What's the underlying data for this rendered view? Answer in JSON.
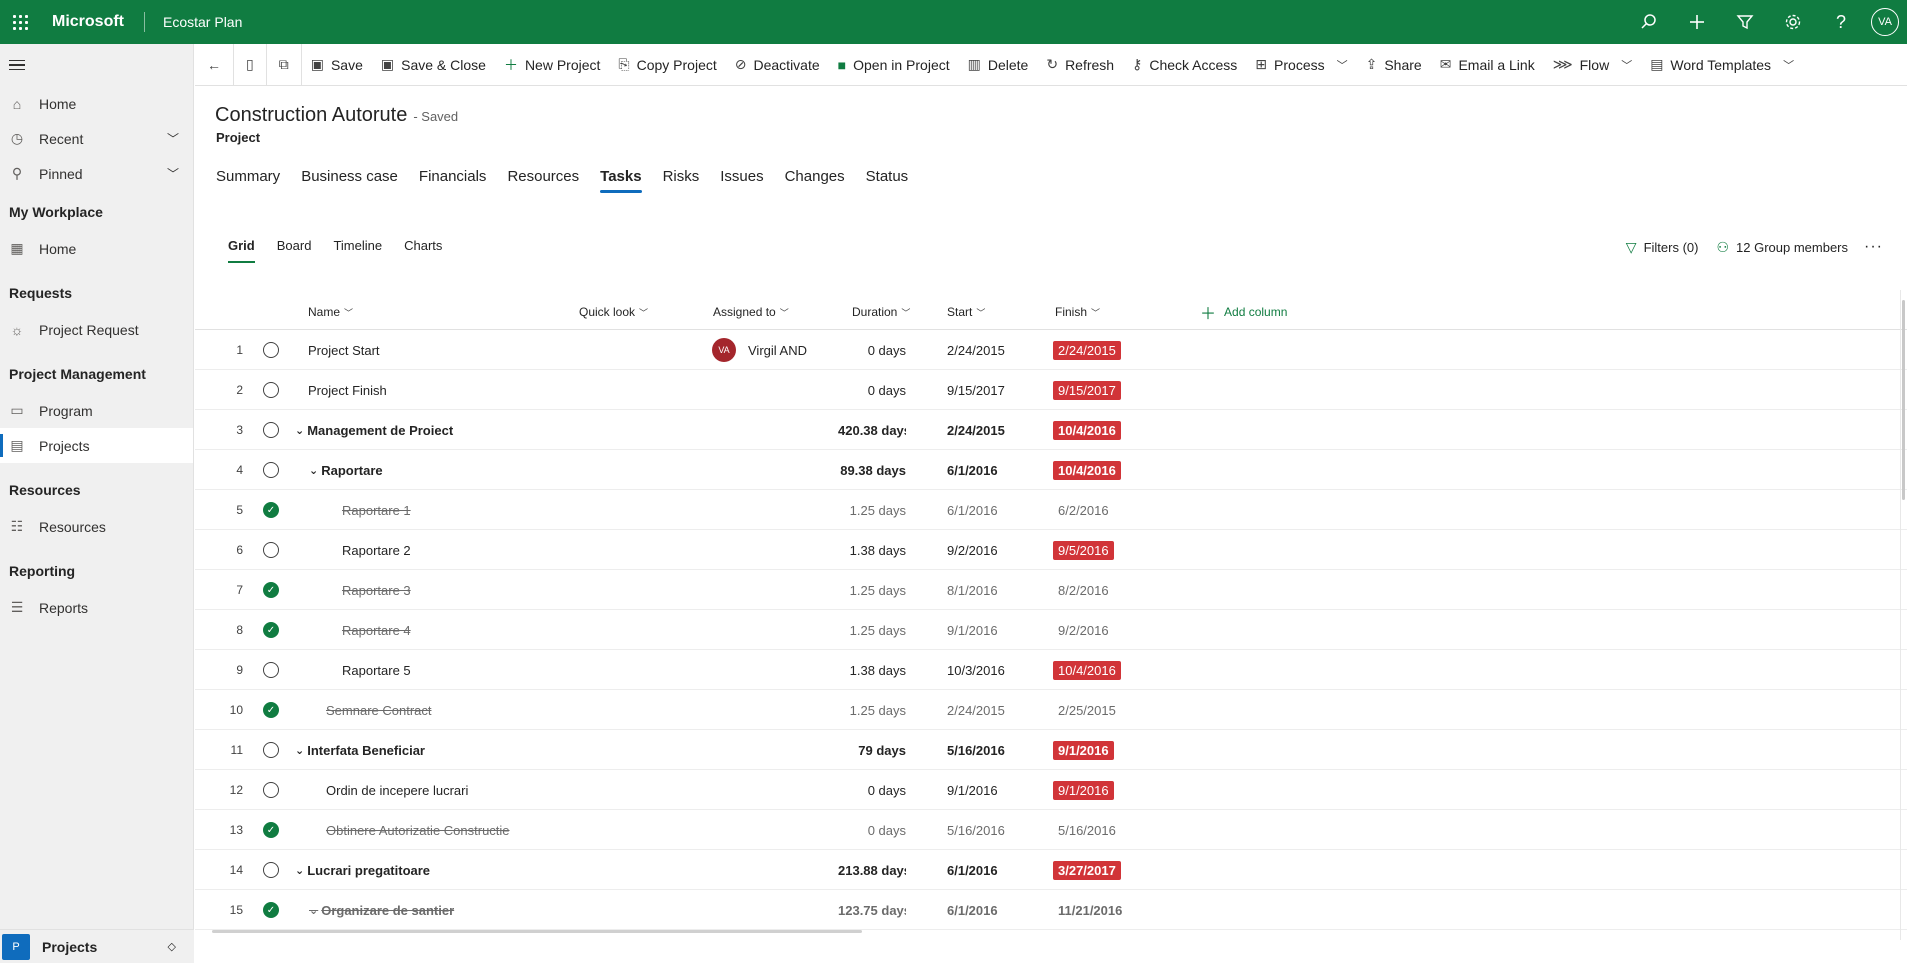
{
  "topbar": {
    "brand": "Microsoft",
    "app_name": "Ecostar Plan",
    "avatar_initials": "VA",
    "icons": [
      "search-icon",
      "plus-icon",
      "filter-icon",
      "gear-icon",
      "help-icon"
    ]
  },
  "nav": {
    "home": "Home",
    "recent": "Recent",
    "pinned": "Pinned",
    "sections": [
      {
        "title": "My Workplace",
        "items": [
          {
            "label": "Home",
            "icon": "dashboard-icon"
          }
        ]
      },
      {
        "title": "Requests",
        "items": [
          {
            "label": "Project Request",
            "icon": "lightbulb-icon"
          }
        ]
      },
      {
        "title": "Project Management",
        "items": [
          {
            "label": "Program",
            "icon": "laptop-icon"
          },
          {
            "label": "Projects",
            "icon": "board-icon",
            "selected": true
          }
        ]
      },
      {
        "title": "Resources",
        "items": [
          {
            "label": "Resources",
            "icon": "person-list-icon"
          }
        ]
      },
      {
        "title": "Reporting",
        "items": [
          {
            "label": "Reports",
            "icon": "clipboard-icon"
          }
        ]
      }
    ],
    "area": {
      "badge": "P",
      "label": "Projects"
    }
  },
  "commandbar": {
    "items": [
      {
        "label": "Save",
        "icon": "save-icon"
      },
      {
        "label": "Save & Close",
        "icon": "save-close-icon"
      },
      {
        "label": "New Project",
        "icon": "plus-icon"
      },
      {
        "label": "Copy Project",
        "icon": "copy-icon"
      },
      {
        "label": "Deactivate",
        "icon": "deactivate-icon"
      },
      {
        "label": "Open in Project",
        "icon": "project-app-icon"
      },
      {
        "label": "Delete",
        "icon": "trash-icon"
      },
      {
        "label": "Refresh",
        "icon": "refresh-icon"
      },
      {
        "label": "Check Access",
        "icon": "key-icon"
      },
      {
        "label": "Process",
        "icon": "process-icon"
      },
      {
        "label": "Share",
        "icon": "share-icon"
      },
      {
        "label": "Email a Link",
        "icon": "mail-icon"
      },
      {
        "label": "Flow",
        "icon": "flow-icon"
      },
      {
        "label": "Word Templates",
        "icon": "word-icon"
      }
    ]
  },
  "record": {
    "title": "Construction Autorute",
    "status": "- Saved",
    "entity": "Project"
  },
  "tabs": [
    "Summary",
    "Business case",
    "Financials",
    "Resources",
    "Tasks",
    "Risks",
    "Issues",
    "Changes",
    "Status"
  ],
  "active_tab": "Tasks",
  "subtabs": [
    "Grid",
    "Board",
    "Timeline",
    "Charts"
  ],
  "active_subtab": "Grid",
  "grid_tools": {
    "filters": "Filters (0)",
    "members": "12 Group members"
  },
  "columns": {
    "name": "Name",
    "quick_look": "Quick look",
    "assigned": "Assigned to",
    "duration": "Duration",
    "start": "Start",
    "finish": "Finish",
    "add_column": "Add column"
  },
  "colors": {
    "brand_green": "#107c41",
    "late_red": "#d13438",
    "nav_accent": "#0f6cbd"
  },
  "tasks": [
    {
      "idx": "1",
      "name": "Project Start",
      "level": 0,
      "summary": false,
      "done": false,
      "assigned": "Virgil AND",
      "assigned_initials": "VA",
      "duration": "0 days",
      "start": "2/24/2015",
      "finish": "2/24/2015",
      "late": true
    },
    {
      "idx": "2",
      "name": "Project Finish",
      "level": 0,
      "summary": false,
      "done": false,
      "assigned": "",
      "duration": "0 days",
      "start": "9/15/2017",
      "finish": "9/15/2017",
      "late": true
    },
    {
      "idx": "3",
      "name": "Management de Proiect",
      "level": 0,
      "summary": true,
      "done": false,
      "assigned": "",
      "duration": "420.38 days",
      "start": "2/24/2015",
      "finish": "10/4/2016",
      "late": true
    },
    {
      "idx": "4",
      "name": "Raportare",
      "level": 1,
      "summary": true,
      "done": false,
      "assigned": "",
      "duration": "89.38 days",
      "start": "6/1/2016",
      "finish": "10/4/2016",
      "late": true
    },
    {
      "idx": "5",
      "name": "Raportare 1",
      "level": 2,
      "summary": false,
      "done": true,
      "assigned": "",
      "duration": "1.25 days",
      "start": "6/1/2016",
      "finish": "6/2/2016",
      "late": false
    },
    {
      "idx": "6",
      "name": "Raportare 2",
      "level": 2,
      "summary": false,
      "done": false,
      "assigned": "",
      "duration": "1.38 days",
      "start": "9/2/2016",
      "finish": "9/5/2016",
      "late": true
    },
    {
      "idx": "7",
      "name": "Raportare 3",
      "level": 2,
      "summary": false,
      "done": true,
      "assigned": "",
      "duration": "1.25 days",
      "start": "8/1/2016",
      "finish": "8/2/2016",
      "late": false
    },
    {
      "idx": "8",
      "name": "Raportare 4",
      "level": 2,
      "summary": false,
      "done": true,
      "assigned": "",
      "duration": "1.25 days",
      "start": "9/1/2016",
      "finish": "9/2/2016",
      "late": false
    },
    {
      "idx": "9",
      "name": "Raportare 5",
      "level": 2,
      "summary": false,
      "done": false,
      "assigned": "",
      "duration": "1.38 days",
      "start": "10/3/2016",
      "finish": "10/4/2016",
      "late": true
    },
    {
      "idx": "10",
      "name": "Semnare Contract",
      "level": 1.5,
      "summary": false,
      "done": true,
      "assigned": "",
      "duration": "1.25 days",
      "start": "2/24/2015",
      "finish": "2/25/2015",
      "late": false
    },
    {
      "idx": "11",
      "name": "Interfata Beneficiar",
      "level": 0,
      "summary": true,
      "done": false,
      "assigned": "",
      "duration": "79 days",
      "start": "5/16/2016",
      "finish": "9/1/2016",
      "late": true
    },
    {
      "idx": "12",
      "name": "Ordin de incepere lucrari",
      "level": 1.5,
      "summary": false,
      "done": false,
      "assigned": "",
      "duration": "0 days",
      "start": "9/1/2016",
      "finish": "9/1/2016",
      "late": true
    },
    {
      "idx": "13",
      "name": "Obtinere Autorizatie Constructie",
      "level": 1.5,
      "summary": false,
      "done": true,
      "assigned": "",
      "duration": "0 days",
      "start": "5/16/2016",
      "finish": "5/16/2016",
      "late": false
    },
    {
      "idx": "14",
      "name": "Lucrari pregatitoare",
      "level": 0,
      "summary": true,
      "done": false,
      "assigned": "",
      "duration": "213.88 days",
      "start": "6/1/2016",
      "finish": "3/27/2017",
      "late": true
    },
    {
      "idx": "15",
      "name": "Organizare de santier",
      "level": 1,
      "summary": true,
      "done": true,
      "assigned": "",
      "duration": "123.75 days",
      "start": "6/1/2016",
      "finish": "11/21/2016",
      "late": false
    }
  ]
}
